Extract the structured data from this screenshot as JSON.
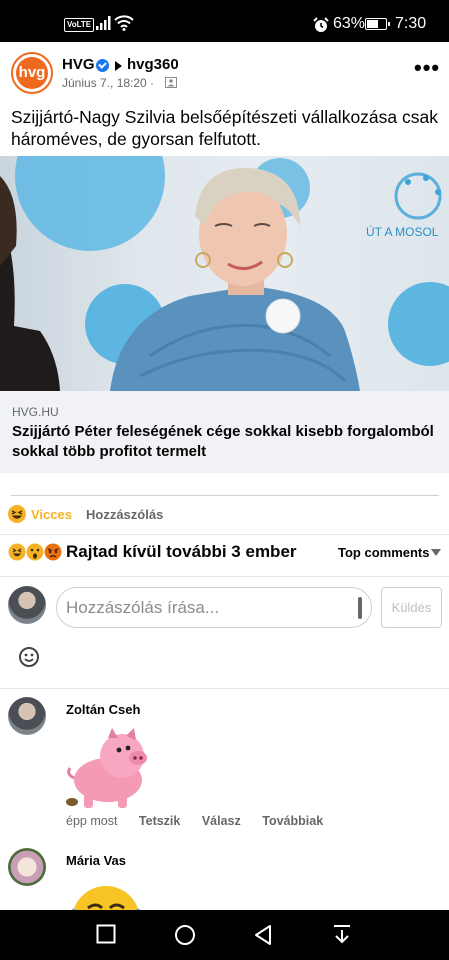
{
  "status_bar": {
    "network_badge": "VoLTE",
    "battery_percent": "63%",
    "battery_level": 0.63,
    "time": "7:30"
  },
  "post": {
    "page_name": "HVG",
    "shared_page": "hvg360",
    "avatar_text": "hvg",
    "timestamp": "Június 7., 18:20 ·",
    "text": "Szijjártó-Nagy Szilvia belsőépítészeti vállalkozása csak hároméves, de gyorsan felfutott.",
    "image_backdrop_text": "ÚT A MOSOL",
    "link": {
      "domain": "HVG.HU",
      "title": "Szijjártó Péter feleségének cége sokkal kisebb forgalomból sokkal több profitot termelt"
    }
  },
  "actions": {
    "reaction_label": "Vicces",
    "comment_label": "Hozzászólás"
  },
  "summary": {
    "text": "Rajtad kívül további 3 ember",
    "sort_label": "Top comments"
  },
  "composer": {
    "placeholder": "Hozzászólás írása...",
    "send_label": "Küldés"
  },
  "comments": [
    {
      "author": "Zoltán Cseh",
      "time": "épp most",
      "like_label": "Tetszik",
      "reply_label": "Válasz",
      "more_label": "Továbbiak"
    },
    {
      "author": "Mária Vas"
    }
  ],
  "colors": {
    "brand_orange": "#ef6a1f",
    "verified_blue": "#1877f2",
    "haha_yellow": "#f7b125",
    "muted": "#65676b"
  }
}
